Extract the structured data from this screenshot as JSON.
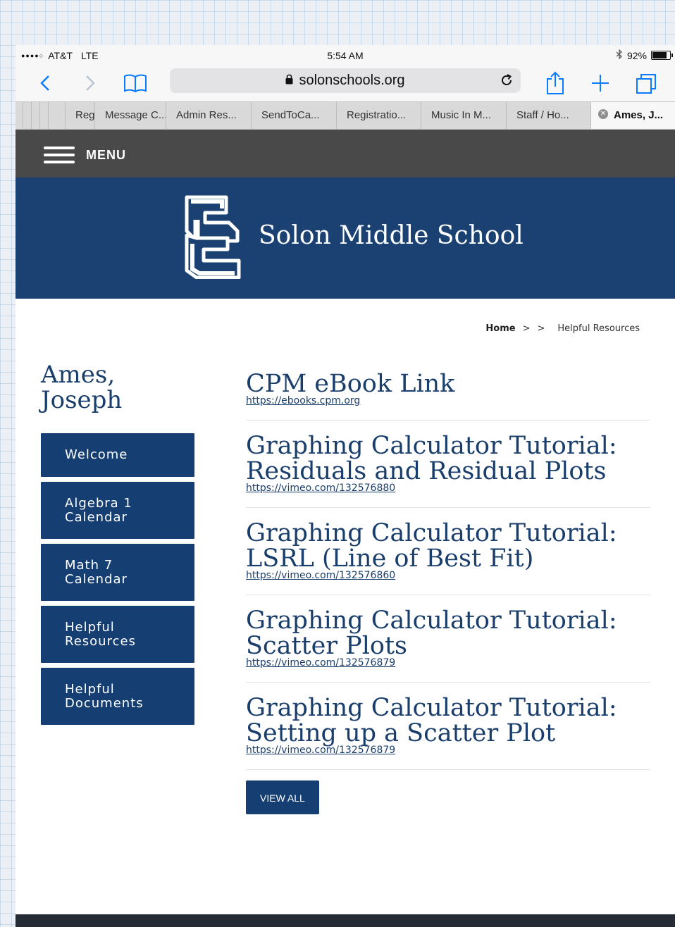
{
  "status": {
    "carrier": "AT&T",
    "network": "LTE",
    "time": "5:54 AM",
    "battery": "92%",
    "battery_level": 0.92
  },
  "browser": {
    "url": "solonschools.org",
    "tabs": [
      {
        "label": "Reg"
      },
      {
        "label": "Message C..."
      },
      {
        "label": "Admin Res..."
      },
      {
        "label": "SendToCa..."
      },
      {
        "label": "Registratio..."
      },
      {
        "label": "Music In M..."
      },
      {
        "label": "Staff / Ho..."
      },
      {
        "label": "Ames, J...",
        "active": true
      }
    ]
  },
  "site": {
    "menu_label": "MENU",
    "school_name": "Solon Middle School",
    "logo_text": "SC",
    "colors": {
      "primary": "#153e72",
      "menubar": "#494949",
      "text": "#1a3e6c"
    }
  },
  "breadcrumb": {
    "home": "Home",
    "separator": ">",
    "current": "Helpful Resources"
  },
  "sidebar": {
    "name": "Ames,\nJoseph",
    "items": [
      {
        "label": "Welcome"
      },
      {
        "label": "Algebra 1\nCalendar"
      },
      {
        "label": "Math 7\nCalendar"
      },
      {
        "label": "Helpful\nResources"
      },
      {
        "label": "Helpful\nDocuments"
      }
    ]
  },
  "posts": [
    {
      "title": "CPM eBook Link",
      "url": "https://ebooks.cpm.org"
    },
    {
      "title": "Graphing Calculator Tutorial:\nResiduals and Residual Plots",
      "url": "https://vimeo.com/132576880"
    },
    {
      "title": "Graphing Calculator Tutorial:\nLSRL (Line of Best Fit)",
      "url": "https://vimeo.com/132576860"
    },
    {
      "title": "Graphing Calculator Tutorial:\nScatter Plots",
      "url": "https://vimeo.com/132576879"
    },
    {
      "title": "Graphing Calculator Tutorial:\nSetting up a Scatter Plot",
      "url": "https://vimeo.com/132576879"
    }
  ],
  "view_all_label": "VIEW ALL"
}
